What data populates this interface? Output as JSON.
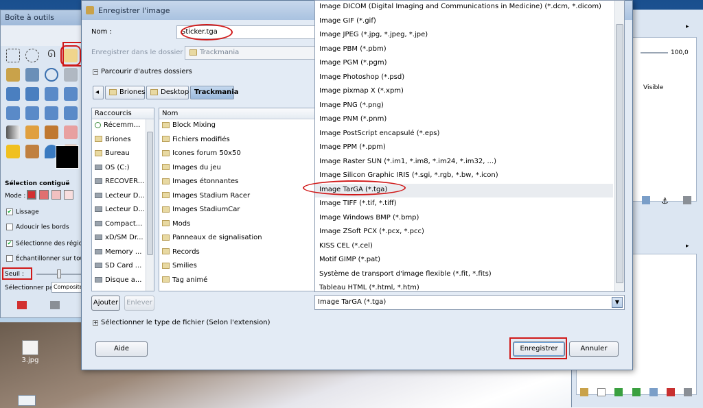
{
  "toolbox": {
    "title": "Boîte à outils",
    "section_title": "Sélection contiguë",
    "mode_label": "Mode :",
    "opt_lissage": "Lissage",
    "opt_adoucir": "Adoucir les bords",
    "opt_selectionne": "Sélectionne des régions",
    "opt_echantillonner": "Échantillonner sur tous",
    "seuil_label": "Seuil :",
    "selectionner_par_label": "Sélectionner par :",
    "selectionner_par_value": "Composite"
  },
  "dock": {
    "opacity_value": "100,0",
    "layer_state": "Visible"
  },
  "desktop": {
    "icon_label": "3.jpg"
  },
  "dialog": {
    "title": "Enregistrer l'image",
    "name_label": "Nom :",
    "name_value": "Sticker.tga",
    "folder_label": "Enregistrer dans le dossier :",
    "folder_value": "Trackmania",
    "browse_label": "Parcourir d'autres dossiers",
    "breadcrumbs": [
      "Briones",
      "Desktop",
      "Trackmania"
    ],
    "places_header": "Raccourcis",
    "places": [
      "Récemm...",
      "Briones",
      "Bureau",
      "OS (C:)",
      "RECOVER...",
      "Lecteur D...",
      "Lecteur D...",
      "Compact...",
      "xD/SM Dr...",
      "Memory ...",
      "SD Card ...",
      "Disque a..."
    ],
    "files_header": "Nom",
    "files": [
      "Block Mixing",
      "Fichiers modifiés",
      "Icones forum 50x50",
      "Images du jeu",
      "Images étonnantes",
      "Images Stadium Racer",
      "Images StadiumCar",
      "Mods",
      "Panneaux de signalisation",
      "Records",
      "Smilies",
      "Tag animé"
    ],
    "add_button": "Ajouter",
    "remove_button": "Enlever",
    "filetype_toggle": "Sélectionner le type de fichier (Selon l'extension)",
    "help_button": "Aide",
    "save_button": "Enregistrer",
    "cancel_button": "Annuler"
  },
  "filetypes": {
    "items": [
      "Image DICOM (Digital Imaging and Communications in Medicine) (*.dcm, *.dicom)",
      "Image GIF (*.gif)",
      "Image JPEG (*.jpg, *.jpeg, *.jpe)",
      "Image PBM (*.pbm)",
      "Image PGM (*.pgm)",
      "Image Photoshop (*.psd)",
      "Image pixmap X (*.xpm)",
      "Image PNG (*.png)",
      "Image PNM (*.pnm)",
      "Image PostScript encapsulé (*.eps)",
      "Image PPM (*.ppm)",
      "Image Raster SUN (*.im1, *.im8, *.im24, *.im32, ...)",
      "Image Silicon Graphic IRIS (*.sgi, *.rgb, *.bw, *.icon)",
      "Image TarGA (*.tga)",
      "Image TIFF (*.tif, *.tiff)",
      "Image Windows BMP (*.bmp)",
      "Image ZSoft PCX (*.pcx, *.pcc)",
      "KISS CEL (*.cel)",
      "Motif GIMP (*.pat)",
      "Système de transport d'image flexible (*.fit, *.fits)",
      "Tableau HTML (*.html, *.htm)"
    ],
    "selected": "Image TarGA (*.tga)"
  },
  "colors": {
    "highlight_red": "#d01818",
    "active_tab": "#9ab9dd"
  }
}
